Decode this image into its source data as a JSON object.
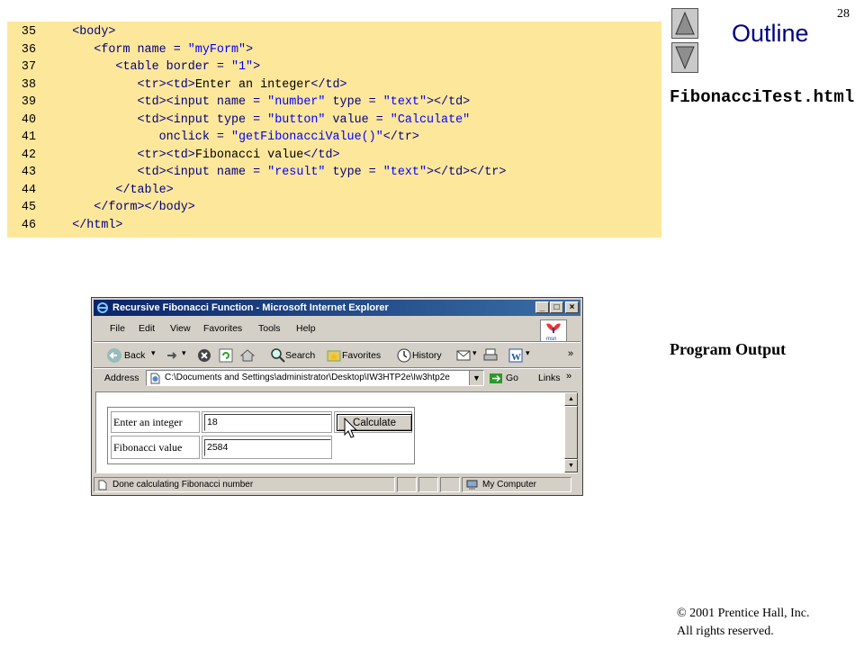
{
  "slide": {
    "page_number": "28",
    "outline_label": "Outline",
    "filename": "FibonacciTest.html",
    "program_output_label": "Program Output",
    "copyright_line1": "© 2001 Prentice Hall, Inc.",
    "copyright_line2": "All rights reserved."
  },
  "code_lines": [
    {
      "num": "35",
      "parts": [
        {
          "t": "   ",
          "c": "t"
        },
        {
          "t": "<body>",
          "c": "k"
        }
      ]
    },
    {
      "num": "36",
      "parts": [
        {
          "t": "      ",
          "c": "t"
        },
        {
          "t": "<form name = ",
          "c": "k"
        },
        {
          "t": "\"myForm\"",
          "c": "s"
        },
        {
          "t": ">",
          "c": "k"
        }
      ]
    },
    {
      "num": "37",
      "parts": [
        {
          "t": "         ",
          "c": "t"
        },
        {
          "t": "<table border = ",
          "c": "k"
        },
        {
          "t": "\"1\"",
          "c": "s"
        },
        {
          "t": ">",
          "c": "k"
        }
      ]
    },
    {
      "num": "38",
      "parts": [
        {
          "t": "            ",
          "c": "t"
        },
        {
          "t": "<tr><td>",
          "c": "k"
        },
        {
          "t": "Enter an integer",
          "c": "t"
        },
        {
          "t": "</td>",
          "c": "k"
        }
      ]
    },
    {
      "num": "39",
      "parts": [
        {
          "t": "            ",
          "c": "t"
        },
        {
          "t": "<td><input name = ",
          "c": "k"
        },
        {
          "t": "\"number\"",
          "c": "s"
        },
        {
          "t": " type = ",
          "c": "k"
        },
        {
          "t": "\"text\"",
          "c": "s"
        },
        {
          "t": "></td>",
          "c": "k"
        }
      ]
    },
    {
      "num": "40",
      "parts": [
        {
          "t": "            ",
          "c": "t"
        },
        {
          "t": "<td><input type = ",
          "c": "k"
        },
        {
          "t": "\"button\"",
          "c": "s"
        },
        {
          "t": " value = ",
          "c": "k"
        },
        {
          "t": "\"Calculate\"",
          "c": "s"
        }
      ]
    },
    {
      "num": "41",
      "parts": [
        {
          "t": "               ",
          "c": "t"
        },
        {
          "t": "onclick = ",
          "c": "k"
        },
        {
          "t": "\"getFibonacciValue()\"",
          "c": "s"
        },
        {
          "t": "</tr>",
          "c": "k"
        }
      ]
    },
    {
      "num": "42",
      "parts": [
        {
          "t": "            ",
          "c": "t"
        },
        {
          "t": "<tr><td>",
          "c": "k"
        },
        {
          "t": "Fibonacci value",
          "c": "t"
        },
        {
          "t": "</td>",
          "c": "k"
        }
      ]
    },
    {
      "num": "43",
      "parts": [
        {
          "t": "            ",
          "c": "t"
        },
        {
          "t": "<td><input name = ",
          "c": "k"
        },
        {
          "t": "\"result\"",
          "c": "s"
        },
        {
          "t": " type = ",
          "c": "k"
        },
        {
          "t": "\"text\"",
          "c": "s"
        },
        {
          "t": "></td></tr>",
          "c": "k"
        }
      ]
    },
    {
      "num": "44",
      "parts": [
        {
          "t": "         ",
          "c": "t"
        },
        {
          "t": "</table>",
          "c": "k"
        }
      ]
    },
    {
      "num": "45",
      "parts": [
        {
          "t": "      ",
          "c": "t"
        },
        {
          "t": "</form></body>",
          "c": "k"
        }
      ]
    },
    {
      "num": "46",
      "parts": [
        {
          "t": "   ",
          "c": "t"
        },
        {
          "t": "</html>",
          "c": "k"
        }
      ]
    }
  ],
  "browser": {
    "title": "Recursive Fibonacci Function - Microsoft Internet Explorer",
    "menus": [
      "File",
      "Edit",
      "View",
      "Favorites",
      "Tools",
      "Help"
    ],
    "toolbar": {
      "back": "Back",
      "search": "Search",
      "favorites": "Favorites",
      "history": "History"
    },
    "address_label": "Address",
    "address_value": "C:\\Documents and Settings\\administrator\\Desktop\\IW3HTP2e\\Iw3htp2e",
    "go_label": "Go",
    "links_label": "Links",
    "form": {
      "label_integer": "Enter an integer",
      "value_integer": "18",
      "button_label": "Calculate",
      "label_result": "Fibonacci value",
      "value_result": "2584"
    },
    "status_text": "Done calculating Fibonacci number",
    "zone_text": "My Computer"
  },
  "colors": {
    "code_bg": "#fde79b",
    "tag": "#000080",
    "string": "#0000ff",
    "titlebar_start": "#0a246a",
    "titlebar_end": "#3a6ea5"
  },
  "icons": [
    "up-arrow-icon",
    "down-arrow-icon",
    "ie-icon",
    "back-icon",
    "forward-icon",
    "stop-icon",
    "refresh-icon",
    "home-icon",
    "search-icon",
    "favorites-icon",
    "history-icon",
    "mail-icon",
    "print-icon",
    "edit-icon",
    "msn-icon",
    "go-arrow-icon",
    "page-icon",
    "computer-icon",
    "cursor-icon"
  ]
}
